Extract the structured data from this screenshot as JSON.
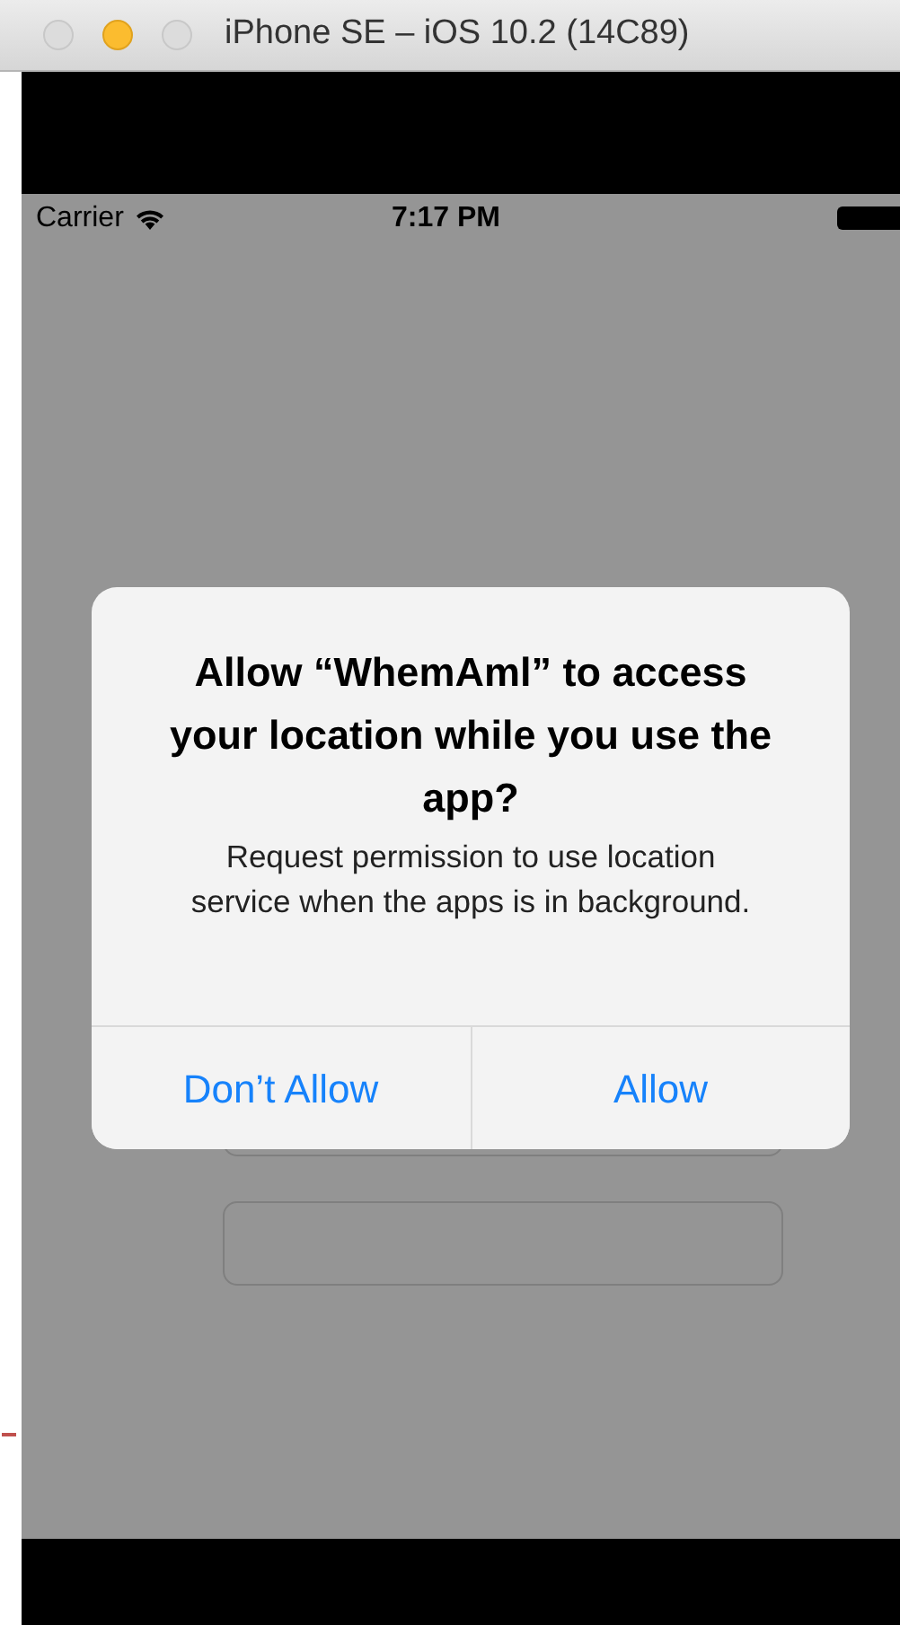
{
  "window": {
    "title": "iPhone SE – iOS 10.2 (14C89)",
    "buttons": [
      {
        "kind": "close"
      },
      {
        "kind": "minimize"
      },
      {
        "kind": "zoom"
      }
    ]
  },
  "status_bar": {
    "carrier": "Carrier",
    "time": "7:17 PM"
  },
  "form": {
    "fields": [
      {
        "kind": "text"
      },
      {
        "kind": "text"
      }
    ]
  },
  "alert": {
    "title": "Allow “WhemAml” to access your location while you use the app?",
    "message": "Request permission to use location service when the apps is in background.",
    "buttons": [
      {
        "label": "Don’t Allow"
      },
      {
        "label": "Allow"
      }
    ]
  }
}
